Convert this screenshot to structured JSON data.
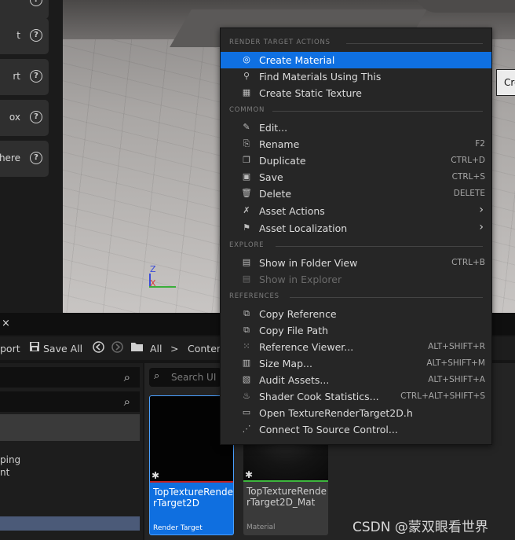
{
  "viewport": {
    "axis_z": "Z",
    "axis_x": "X",
    "tooltip_text": "Cre"
  },
  "place_panel": {
    "items": [
      {
        "label": "t"
      },
      {
        "label": "rt"
      },
      {
        "label": "ox"
      },
      {
        "label": "phere"
      }
    ],
    "help_glyph": "?"
  },
  "content_browser": {
    "tab_close": "×",
    "toolbar": {
      "import_label": "port",
      "save_all_label": "Save All",
      "back_icon": "◀",
      "fwd_icon": "▶",
      "breadcrumb_all": "All",
      "breadcrumb_sep": ">",
      "breadcrumb_content": "Content"
    },
    "sources": {
      "text_1": "ping",
      "text_2": "nt"
    },
    "search": {
      "placeholder": "Search UI",
      "icon": "⌕"
    },
    "assets": [
      {
        "name": "TopTextureRenderTarget2D",
        "type": "Render Target",
        "star": "✱"
      },
      {
        "name": "TopTextureRenderTarget2D_Mat",
        "type": "Material",
        "star": "✱"
      }
    ]
  },
  "context_menu": {
    "sections": [
      {
        "title": "RENDER TARGET ACTIONS",
        "items": [
          {
            "label": "Create Material",
            "icon": "create-material-icon",
            "glyph": "◎",
            "shortcut": "",
            "highlighted": true
          },
          {
            "label": "Find Materials Using This",
            "icon": "find-icon",
            "glyph": "⚲",
            "shortcut": ""
          },
          {
            "label": "Create Static Texture",
            "icon": "checker-icon",
            "glyph": "▦",
            "shortcut": ""
          }
        ]
      },
      {
        "title": "COMMON",
        "items": [
          {
            "label": "Edit...",
            "icon": "pencil-icon",
            "glyph": "✎",
            "shortcut": ""
          },
          {
            "label": "Rename",
            "icon": "rename-icon",
            "glyph": "⎘",
            "shortcut": "F2"
          },
          {
            "label": "Duplicate",
            "icon": "duplicate-icon",
            "glyph": "❐",
            "shortcut": "CTRL+D"
          },
          {
            "label": "Save",
            "icon": "save-icon",
            "glyph": "▣",
            "shortcut": "CTRL+S"
          },
          {
            "label": "Delete",
            "icon": "trash-icon",
            "glyph": "🗑",
            "shortcut": "DELETE"
          },
          {
            "label": "Asset Actions",
            "icon": "wrench-icon",
            "glyph": "✗",
            "shortcut": "",
            "submenu": true
          },
          {
            "label": "Asset Localization",
            "icon": "flag-icon",
            "glyph": "⚑",
            "shortcut": "",
            "submenu": true
          }
        ]
      },
      {
        "title": "EXPLORE",
        "items": [
          {
            "label": "Show in Folder View",
            "icon": "folder-search-icon",
            "glyph": "▤",
            "shortcut": "CTRL+B"
          },
          {
            "label": "Show in Explorer",
            "icon": "explorer-icon",
            "glyph": "▤",
            "shortcut": "",
            "disabled": true
          }
        ]
      },
      {
        "title": "REFERENCES",
        "items": [
          {
            "label": "Copy Reference",
            "icon": "copy-reference-icon",
            "glyph": "⧉",
            "shortcut": ""
          },
          {
            "label": "Copy File Path",
            "icon": "copy-path-icon",
            "glyph": "⧉",
            "shortcut": ""
          },
          {
            "label": "Reference Viewer...",
            "icon": "reference-viewer-icon",
            "glyph": "⁙",
            "shortcut": "ALT+SHIFT+R"
          },
          {
            "label": "Size Map...",
            "icon": "size-map-icon",
            "glyph": "▥",
            "shortcut": "ALT+SHIFT+M"
          },
          {
            "label": "Audit Assets...",
            "icon": "audit-icon",
            "glyph": "▧",
            "shortcut": "ALT+SHIFT+A"
          },
          {
            "label": "Shader Cook Statistics...",
            "icon": "shader-stats-icon",
            "glyph": "♨",
            "shortcut": "CTRL+ALT+SHIFT+S"
          },
          {
            "label": "Open TextureRenderTarget2D.h",
            "icon": "header-file-icon",
            "glyph": "▭",
            "shortcut": ""
          },
          {
            "label": "Connect To Source Control...",
            "icon": "source-control-icon",
            "glyph": "⋰",
            "shortcut": ""
          }
        ]
      }
    ],
    "submenu_arrow": "›"
  },
  "watermark": "CSDN @蒙双眼看世界",
  "colors": {
    "highlight": "#0f70e2",
    "menu_bg": "#262626",
    "selected_tile": "#0f6fe0"
  }
}
